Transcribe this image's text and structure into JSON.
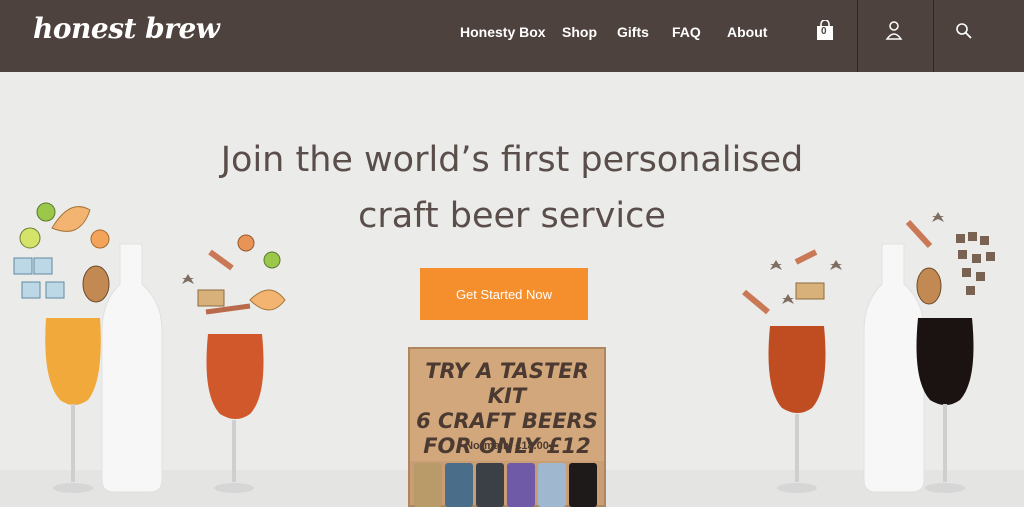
{
  "brand": {
    "logo": "honest brew"
  },
  "nav": {
    "items": [
      "Honesty Box",
      "Shop",
      "Gifts",
      "FAQ",
      "About"
    ],
    "cart_count": "0"
  },
  "hero": {
    "headline_line1": "Join the world’s first personalised",
    "headline_line2": "craft beer service",
    "cta_label": "Get Started Now"
  },
  "taster_box": {
    "line1": "TRY A TASTER KIT",
    "line2": "6 CRAFT BEERS",
    "line3": "FOR ONLY £12",
    "normally": "Normally £18.00"
  },
  "colors": {
    "nav_bg": "#4e423f",
    "cta": "#f58f2e",
    "page_bg": "#ebebea"
  }
}
